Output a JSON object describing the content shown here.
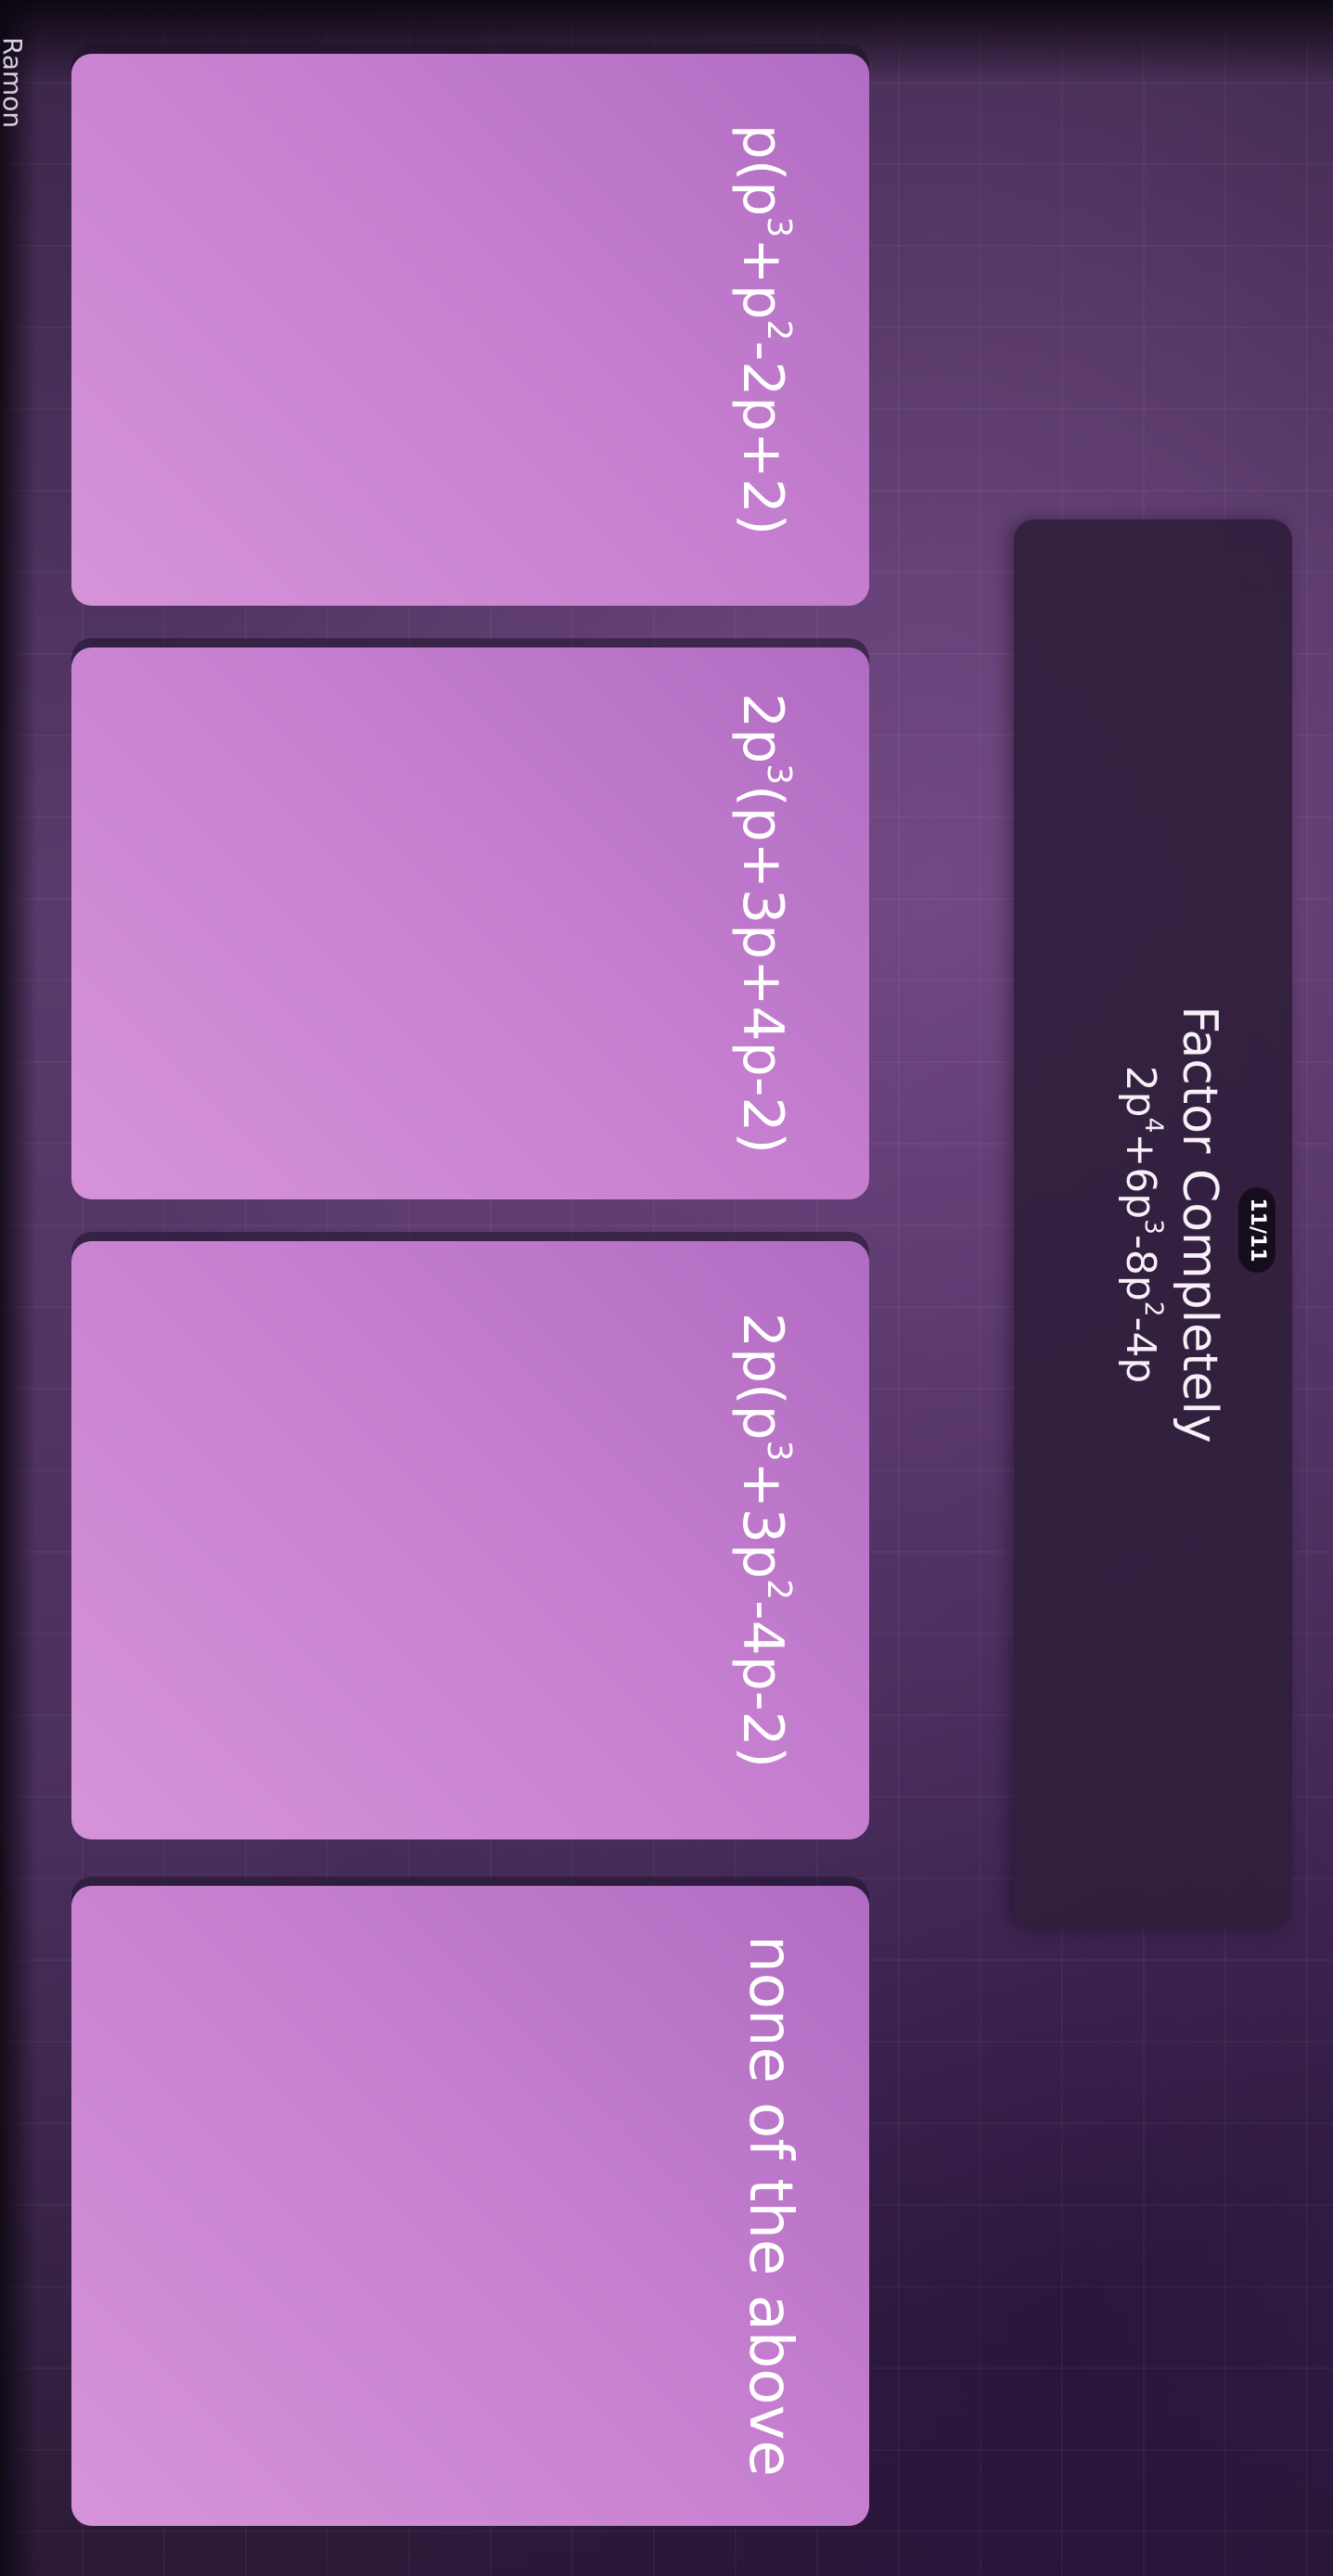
{
  "player": {
    "name": "Ramon"
  },
  "question": {
    "counter": "11/11",
    "title": "Factor Completely",
    "expression_parts": [
      "2p",
      "4",
      "+6p",
      "3",
      "-8p",
      "2",
      "-4p"
    ]
  },
  "answers": [
    {
      "parts": [
        "p(p",
        "3",
        "+p",
        "2",
        "-2p+2)"
      ]
    },
    {
      "parts": [
        "2p",
        "3",
        "(p+3p+4p-2)"
      ]
    },
    {
      "parts": [
        "2p(p",
        "3",
        "+3p",
        "2",
        "-4p-2)"
      ]
    },
    {
      "text": "none of the above"
    }
  ],
  "colors": {
    "card": "#c67fd0",
    "question_panel": "#301e3c",
    "background": "#4b2f5d"
  }
}
